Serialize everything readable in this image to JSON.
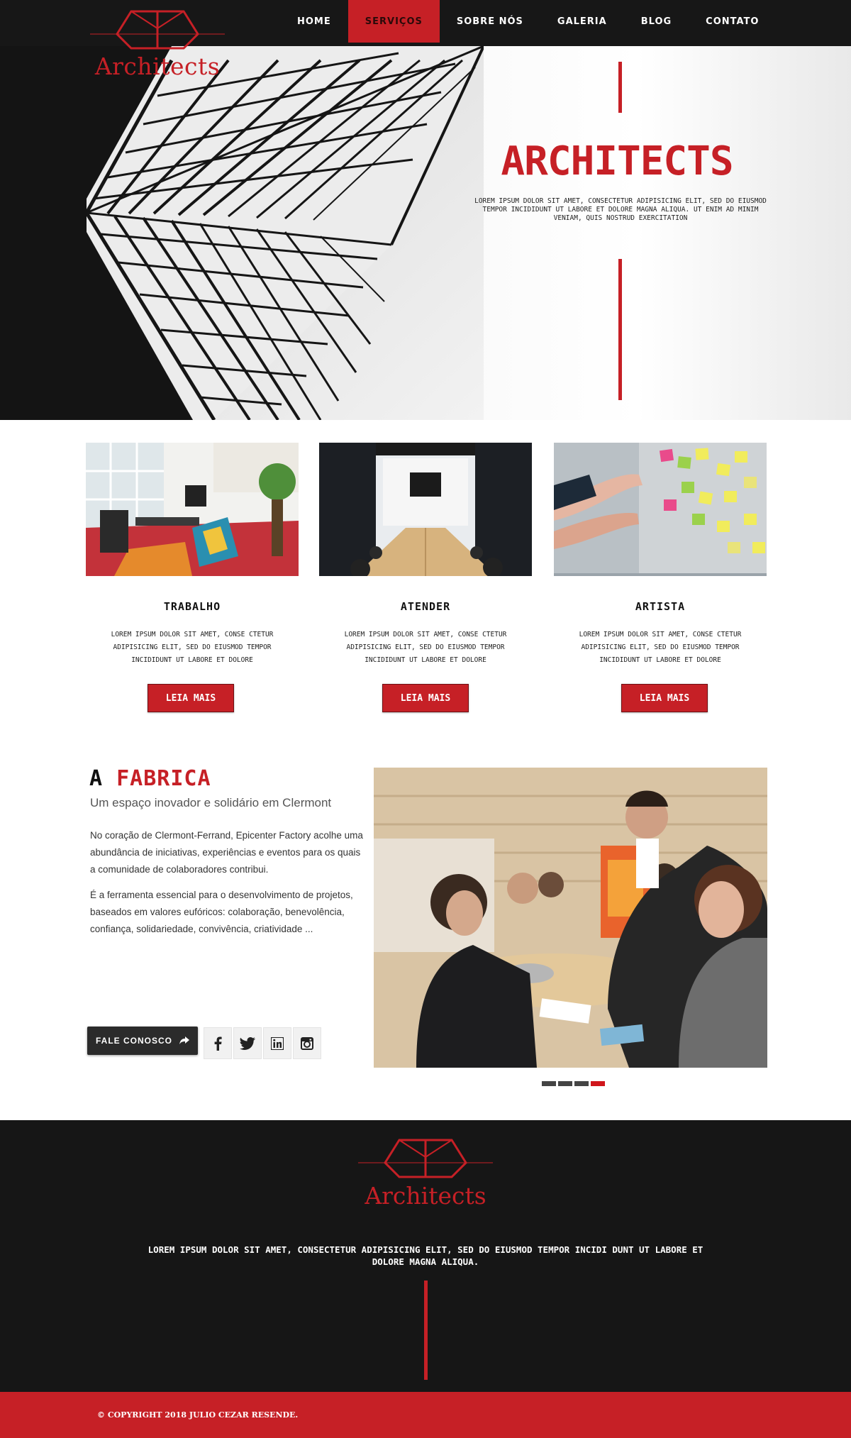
{
  "brand": {
    "name": "Architects",
    "accent": "#c62026",
    "dark": "#171717"
  },
  "nav": {
    "items": [
      {
        "label": "HOME"
      },
      {
        "label": "SERVIÇOS"
      },
      {
        "label": "SOBRE NÓS"
      },
      {
        "label": "GALERIA"
      },
      {
        "label": "BLOG"
      },
      {
        "label": "CONTATO"
      }
    ],
    "active": "SERVIÇOS"
  },
  "hero": {
    "title": "ARCHITECTS",
    "text": "LOREM IPSUM DOLOR SIT AMET, CONSECTETUR ADIPISICING ELIT, SED DO EIUSMOD TEMPOR INCIDIDUNT UT LABORE ET DOLORE MAGNA ALIQUA. UT ENIM AD MINIM VENIAM, QUIS NOSTRUD EXERCITATION"
  },
  "services": [
    {
      "title": "TRABALHO",
      "text": "LOREM IPSUM DOLOR SIT AMET, CONSE CTETUR ADIPISICING ELIT, SED DO EIUSMOD TEMPOR INCIDIDUNT UT LABORE ET DOLORE",
      "button": "LEIA MAIS"
    },
    {
      "title": "ATENDER",
      "text": "LOREM IPSUM DOLOR SIT AMET, CONSE CTETUR ADIPISICING ELIT, SED DO EIUSMOD TEMPOR INCIDIDUNT UT LABORE ET DOLORE",
      "button": "LEIA MAIS"
    },
    {
      "title": "ARTISTA",
      "text": "LOREM IPSUM DOLOR SIT AMET, CONSE CTETUR ADIPISICING ELIT, SED DO EIUSMOD TEMPOR INCIDIDUNT UT LABORE ET DOLORE",
      "button": "LEIA MAIS"
    }
  ],
  "fabrica": {
    "title_prefix": "A",
    "title_accent": "FABRICA",
    "subtitle": "Um espaço inovador e solidário em Clermont",
    "paragraphs": [
      "No coração de Clermont-Ferrand, Epicenter Factory acolhe uma abundância de iniciativas, experiências e eventos para os quais a comunidade de colaboradores contribui.",
      "É a ferramenta essencial para o desenvolvimento de projetos, baseados em valores eufóricos: colaboração, benevolência, confiança, solidariedade, convivência, criatividade ..."
    ],
    "contact_button": "FALE CONOSCO",
    "contact_icon": "share-arrow-icon",
    "social": [
      {
        "icon": "facebook-icon",
        "glyph": "f"
      },
      {
        "icon": "twitter-icon",
        "glyph": "t"
      },
      {
        "icon": "linkedin-icon",
        "glyph": "in"
      },
      {
        "icon": "instagram-icon",
        "glyph": "ig"
      }
    ],
    "slider": {
      "slides": 4,
      "active": 4
    }
  },
  "footer": {
    "logo_text": "Architects",
    "text": "LOREM IPSUM DOLOR SIT AMET, CONSECTETUR ADIPISICING ELIT, SED DO EIUSMOD TEMPOR INCIDI DUNT UT LABORE ET DOLORE MAGNA ALIQUA.",
    "copyright": "© COPYRIGHT 2018 JULIO CEZAR RESENDE."
  }
}
